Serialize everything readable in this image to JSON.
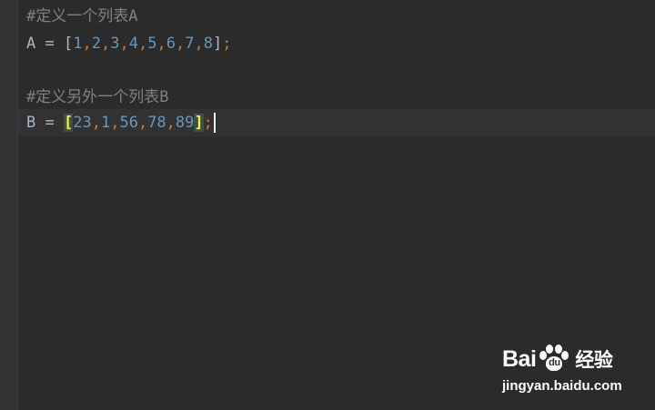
{
  "editor": {
    "line1_comment": "#定义一个列表A",
    "line2": {
      "name": "A",
      "assign": " = ",
      "open": "[",
      "numbers": [
        "1",
        "2",
        "3",
        "4",
        "5",
        "6",
        "7",
        "8"
      ],
      "comma": ",",
      "close": "]",
      "semicolon": ";"
    },
    "line4_comment": "#定义另外一个列表B",
    "line5": {
      "name": "B",
      "assign": " = ",
      "open": "[",
      "numbers": [
        "23",
        "1",
        "56",
        "78",
        "89"
      ],
      "comma": ",",
      "close": "]",
      "semicolon": ";"
    }
  },
  "colors": {
    "background": "#2b2b2b",
    "comment": "#808080",
    "number": "#6897bb",
    "comma": "#cc7832",
    "bracket_match": "#ffef28"
  },
  "watermark": {
    "brand_left": "Bai",
    "paw_text": "du",
    "brand_cn": "经验",
    "url": "jingyan.baidu.com"
  }
}
